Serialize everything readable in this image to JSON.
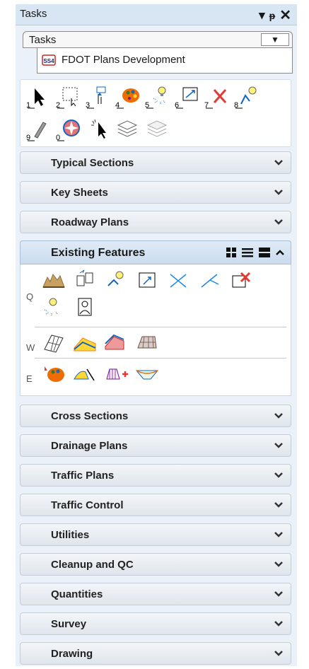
{
  "window": {
    "title": "Tasks",
    "controls": [
      "dropdown-arrow",
      "pin",
      "close"
    ]
  },
  "tabs": {
    "active": "Tasks",
    "dropdown_glyph": "▼"
  },
  "workflow": {
    "name": "FDOT Plans Development"
  },
  "toolbox": {
    "numbers": [
      "1",
      "2",
      "3",
      "4",
      "5",
      "6",
      "7",
      "8",
      "9",
      "0"
    ],
    "icons": [
      "select-arrow-icon",
      "select-rectangle-icon",
      "copy-move-icon",
      "palette-icon",
      "lightbulb-locate-icon",
      "zoom-extents-icon",
      "red-x-delete-icon",
      "lightbulb-connect-icon",
      "pen-icon",
      "compass-icon",
      "cursor-sparkle-icon",
      "layers-icon",
      "layers-gray-icon"
    ]
  },
  "sections_top": [
    "Typical Sections",
    "Key Sheets",
    "Roadway Plans"
  ],
  "expanded": {
    "label": "Existing Features",
    "rows": [
      {
        "label": "Q",
        "icons": [
          "terrain-icon",
          "copy-file-icon",
          "lightbulb-pick-icon",
          "zoom-box-icon",
          "cross-lines-icon",
          "angle-lines-icon",
          "delete-red-icon",
          "lightbulb-select-icon",
          "clipboard-person-icon"
        ]
      },
      {
        "label": "W",
        "icons": [
          "grid-mesh-icon",
          "surface-slope-icon",
          "surface-stack-icon",
          "surface-grid-icon"
        ]
      },
      {
        "label": "E",
        "icons": [
          "palette-fire-icon",
          "corridor-curve-icon",
          "template-add-icon",
          "surface-wedge-icon"
        ]
      }
    ]
  },
  "sections_bottom": [
    "Cross Sections",
    "Drainage Plans",
    "Traffic Plans",
    "Traffic Control",
    "Utilities",
    "Cleanup and QC",
    "Quantities",
    "Survey",
    "Drawing"
  ],
  "colors": {
    "panel_bg": "#eaf1f8",
    "header_active": "#cbdcee",
    "accent_red": "#e53935"
  }
}
